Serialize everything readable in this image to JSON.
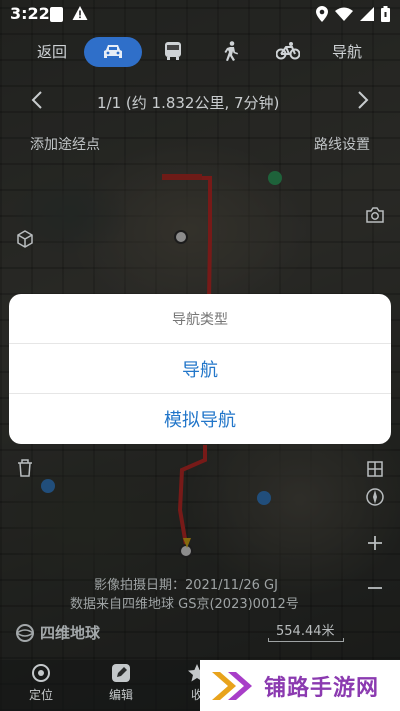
{
  "status_bar": {
    "time": "3:22",
    "icons": [
      "notification-box-icon",
      "warning-icon",
      "location-icon",
      "wifi-icon",
      "battery-icon"
    ]
  },
  "route_modes": {
    "back_label": "返回",
    "selected_mode": "drive",
    "nav_label": "导航",
    "accent_color": "#2f6fc9"
  },
  "route_info": {
    "text": "1/1  (约 1.832公里, 7分钟)"
  },
  "map_controls": {
    "add_waypoint": "添加途经点",
    "route_settings": "路线设置"
  },
  "map_overlay": {
    "photo_date": "影像拍摄日期：2021/11/26 GJ",
    "data_source": "数据来自四维地球 GS京(2023)0012号",
    "brand": "四维地球",
    "scale": "554.44米"
  },
  "bottom_nav": {
    "locate": "定位",
    "edit": "编辑",
    "collect": "收"
  },
  "promo": {
    "text": "铺路手游网",
    "color": "#8b3ab0"
  },
  "dialog": {
    "title": "导航类型",
    "options": [
      "导航",
      "模拟导航"
    ],
    "option_color": "#2276c9"
  }
}
